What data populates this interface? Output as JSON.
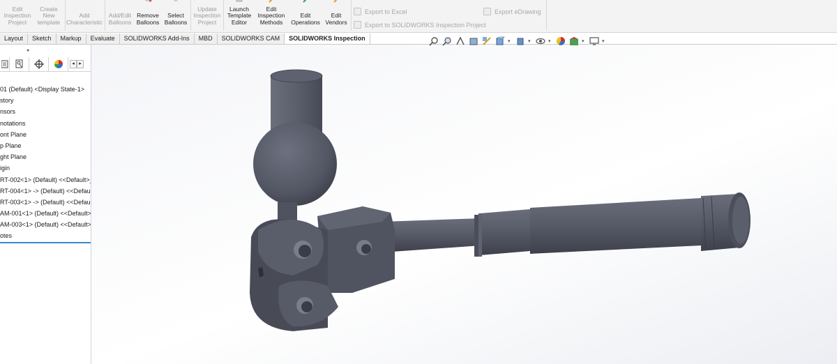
{
  "ribbon": {
    "buttons": [
      {
        "name": "edit-inspection-project-button",
        "label": "Edit\nInspection\nProject",
        "enabled": false
      },
      {
        "name": "create-new-template-button",
        "label": "Create\nNew\ntemplate",
        "enabled": false
      },
      {
        "name": "add-characteristic-button",
        "label": "Add\nCharacteristic",
        "enabled": false
      },
      {
        "name": "add-edit-balloons-button",
        "label": "Add/Edit\nBalloons",
        "enabled": false
      },
      {
        "name": "remove-balloons-button",
        "label": "Remove\nBalloons",
        "enabled": true
      },
      {
        "name": "select-balloons-button",
        "label": "Select\nBalloons",
        "enabled": true
      },
      {
        "name": "update-inspection-project-button",
        "label": "Update\nInspection\nProject",
        "enabled": false
      },
      {
        "name": "launch-template-editor-button",
        "label": "Launch\nTemplate\nEditor",
        "enabled": true
      },
      {
        "name": "edit-inspection-methods-button",
        "label": "Edit\nInspection\nMethods",
        "enabled": true
      },
      {
        "name": "edit-operations-button",
        "label": "Edit\nOperations",
        "enabled": true
      },
      {
        "name": "edit-vendors-button",
        "label": "Edit\nVendors",
        "enabled": true
      }
    ],
    "exports": {
      "excel": "Export to Excel",
      "inspection_project": "Export to SOLIDWORKS Inspection Project",
      "edrawing": "Export eDrawing"
    }
  },
  "tabs": [
    "Layout",
    "Sketch",
    "Markup",
    "Evaluate",
    "SOLIDWORKS Add-Ins",
    "MBD",
    "SOLIDWORKS CAM",
    "SOLIDWORKS Inspection"
  ],
  "active_tab": "SOLIDWORKS Inspection",
  "feature_tree": {
    "items": [
      "01 (Default) <Display State-1>",
      "story",
      "nsors",
      "notations",
      "ont Plane",
      "p Plane",
      "ght Plane",
      "igin",
      "RT-002<1> (Default) <<Default>_",
      "RT-004<1> -> (Default) <<Defaul",
      "RT-003<1> -> (Default) <<Defaul",
      "AM-001<1> (Default) <<Default>_",
      "AM-003<1> (Default) <<Default>_",
      "otes"
    ]
  },
  "colors": {
    "model_gray": "#5a5e6b",
    "model_dark": "#3a3d47",
    "model_light": "#8a8e9b",
    "accent_blue": "#3c86c6"
  },
  "hud_icons": [
    "zoom-to-fit-icon",
    "zoom-to-area-icon",
    "previous-view-icon",
    "section-view-icon",
    "dynamic-annotation-icon",
    "view-orientation-icon",
    "display-style-icon",
    "hide-show-items-icon",
    "edit-appearance-icon",
    "apply-scene-icon",
    "view-settings-icon"
  ]
}
